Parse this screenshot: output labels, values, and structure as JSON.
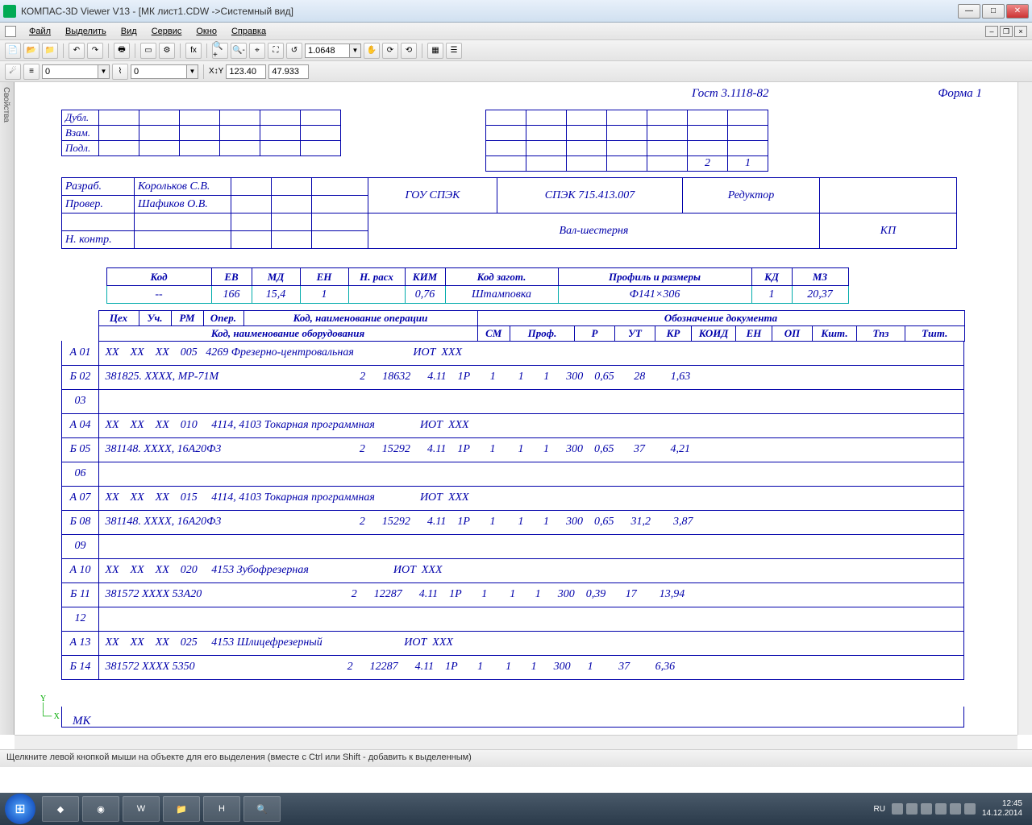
{
  "window": {
    "title": "КОМПАС-3D Viewer V13 - [МК лист1.CDW ->Системный вид]"
  },
  "menu": {
    "file": "Файл",
    "select": "Выделить",
    "view": "Вид",
    "service": "Сервис",
    "window": "Окно",
    "help": "Справка"
  },
  "toolbar": {
    "zoom_value": "1.0648",
    "stepper1": "0",
    "stepper2": "0",
    "coord_x": "123.40",
    "coord_y": "47.933"
  },
  "side": {
    "label": "Свойства"
  },
  "drawing": {
    "gost": "Гост 3.1118-82",
    "form": "Форма 1",
    "dubl": "Дубл.",
    "vzam": "Взам.",
    "podl": "Подл.",
    "sheet_num": "2",
    "sheet_of": "1",
    "razrab": "Разраб.",
    "prover": "Провер.",
    "nkontr": "Н. контр.",
    "dev_name": "Корольков С.В.",
    "check_name": "Шафиков О.В.",
    "org": "ГОУ СПЭК",
    "code": "СПЭК 715.413.007",
    "product": "Редуктор",
    "part": "Вал-шестерня",
    "kp": "КП",
    "mat_headers": {
      "kod": "Код",
      "ev": "ЕВ",
      "md": "МД",
      "en": "ЕН",
      "nrash": "Н. расх",
      "kim": "КИМ",
      "kodz": "Код загот.",
      "prof": "Профиль и размеры",
      "kd": "КД",
      "mz": "МЗ"
    },
    "mat_values": {
      "kod": "--",
      "ev": "166",
      "md": "15,4",
      "en": "1",
      "nrash": "",
      "kim": "0,76",
      "kodz": "Штамповка",
      "prof": "Ф141×306",
      "kd": "1",
      "mz": "20,37"
    },
    "col1": {
      "ceh": "Цех",
      "uch": "Уч.",
      "rm": "РМ",
      "oper": "Опер.",
      "kodnaim": "Код, наименование операции",
      "obozn": "Обозначение документа"
    },
    "col2": {
      "kodobor": "Код, наименование оборудования",
      "sm": "СМ",
      "prof": "Проф.",
      "r": "Р",
      "ut": "УТ",
      "kr": "КР",
      "koid": "КОИД",
      "en": "ЕН",
      "op": "ОП",
      "ksht": "Кшт.",
      "tpz": "Тпз",
      "tsht": "Тшт."
    },
    "rows": [
      {
        "idx": "А 01",
        "t": " ХХ    ХХ    ХХ    005   4269 Фрезерно-центровальная                     ИОТ  ХХХ"
      },
      {
        "idx": "Б 02",
        "t": " 381825. ХХХХ, МР-71М                                                  2      18632      4.11    1Р       1        1       1      300    0,65       28         1,63"
      },
      {
        "idx": "03",
        "t": ""
      },
      {
        "idx": "А 04",
        "t": " ХХ    ХХ    ХХ    010     4114, 4103 Токарная программная                ИОТ  ХХХ"
      },
      {
        "idx": "Б 05",
        "t": " 381148. ХХХХ, 16А20Ф3                                                 2      15292      4.11    1Р       1        1       1      300    0,65       37         4,21"
      },
      {
        "idx": "06",
        "t": ""
      },
      {
        "idx": "А 07",
        "t": " ХХ    ХХ    ХХ    015     4114, 4103 Токарная программная                ИОТ  ХХХ"
      },
      {
        "idx": "Б 08",
        "t": " 381148. ХХХХ, 16А20Ф3                                                 2      15292      4.11    1Р       1        1       1      300    0,65      31,2        3,87"
      },
      {
        "idx": "09",
        "t": ""
      },
      {
        "idx": "А 10",
        "t": " ХХ    ХХ    ХХ    020     4153 Зубофрезерная                              ИОТ  ХХХ"
      },
      {
        "idx": "Б 11",
        "t": " 381572 ХХХХ 53А20                                                     2      12287      4.11    1Р       1        1       1      300    0,39       17        13,94"
      },
      {
        "idx": "12",
        "t": ""
      },
      {
        "idx": "А 13",
        "t": " ХХ    ХХ    ХХ    025     4153 Шлицефрезерный                             ИОТ  ХХХ"
      },
      {
        "idx": "Б 14",
        "t": " 381572 ХХХХ 5350                                                      2      12287      4.11    1Р       1        1       1      300      1         37         6,36"
      }
    ],
    "mk": "МК"
  },
  "status": {
    "hint": "Щелкните левой кнопкой мыши на объекте для его выделения (вместе с Ctrl или Shift - добавить к выделенным)"
  },
  "tray": {
    "lang": "RU",
    "time": "12:45",
    "date": "14.12.2014"
  }
}
